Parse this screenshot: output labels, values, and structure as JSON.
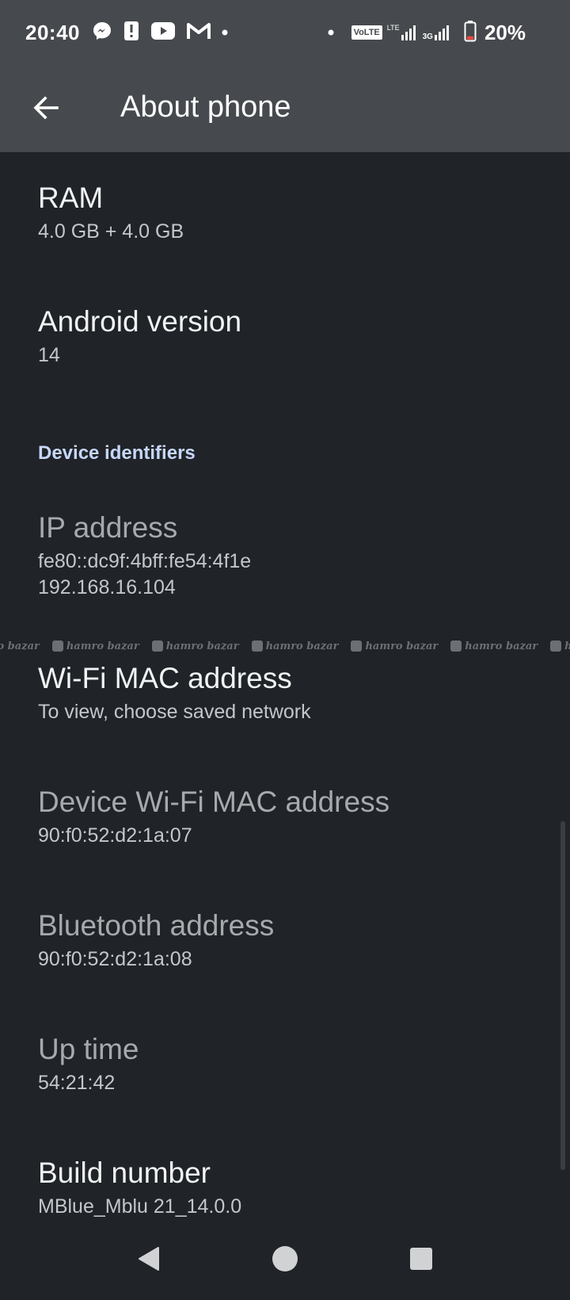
{
  "status_bar": {
    "time": "20:40",
    "battery_percent": "20%",
    "left_icons": [
      "messenger-icon",
      "alert-icon",
      "youtube-icon",
      "gmail-icon",
      "more-dot-icon"
    ],
    "right_icons": [
      "dot-icon",
      "volte-icon",
      "lte-signal-icon",
      "3g-signal-icon",
      "battery-icon"
    ],
    "volte_label": "VoLTE",
    "lte_label": "LTE",
    "g3_label": "3G",
    "battery_level": 0.2
  },
  "app_bar": {
    "title": "About phone"
  },
  "items_top": [
    {
      "title": "RAM",
      "summary": "4.0 GB + 4.0 GB",
      "enabled": true
    },
    {
      "title": "Android version",
      "summary": "14",
      "enabled": true
    }
  ],
  "section": {
    "header": "Device identifiers"
  },
  "items_identifiers": [
    {
      "title": "IP address",
      "summary": "fe80::dc9f:4bff:fe54:4f1e\n192.168.16.104",
      "enabled": false
    },
    {
      "title": "Wi-Fi MAC address",
      "summary": "To view, choose saved network",
      "enabled": true
    },
    {
      "title": "Device Wi-Fi MAC address",
      "summary": "90:f0:52:d2:1a:07",
      "enabled": false
    },
    {
      "title": "Bluetooth address",
      "summary": "90:f0:52:d2:1a:08",
      "enabled": false
    },
    {
      "title": "Up time",
      "summary": "54:21:42",
      "enabled": false
    },
    {
      "title": "Build number",
      "summary": "MBlue_Mblu 21_14.0.0",
      "enabled": true
    }
  ],
  "watermark": {
    "text": "hamro bazar"
  },
  "nav_bar": {
    "icons": [
      "back-triangle-icon",
      "home-circle-icon",
      "recents-square-icon"
    ]
  },
  "colors": {
    "bar_background": "#46494d",
    "page_background": "#202327",
    "section_header": "#c7d7fb",
    "battery_low": "#e5483d"
  }
}
